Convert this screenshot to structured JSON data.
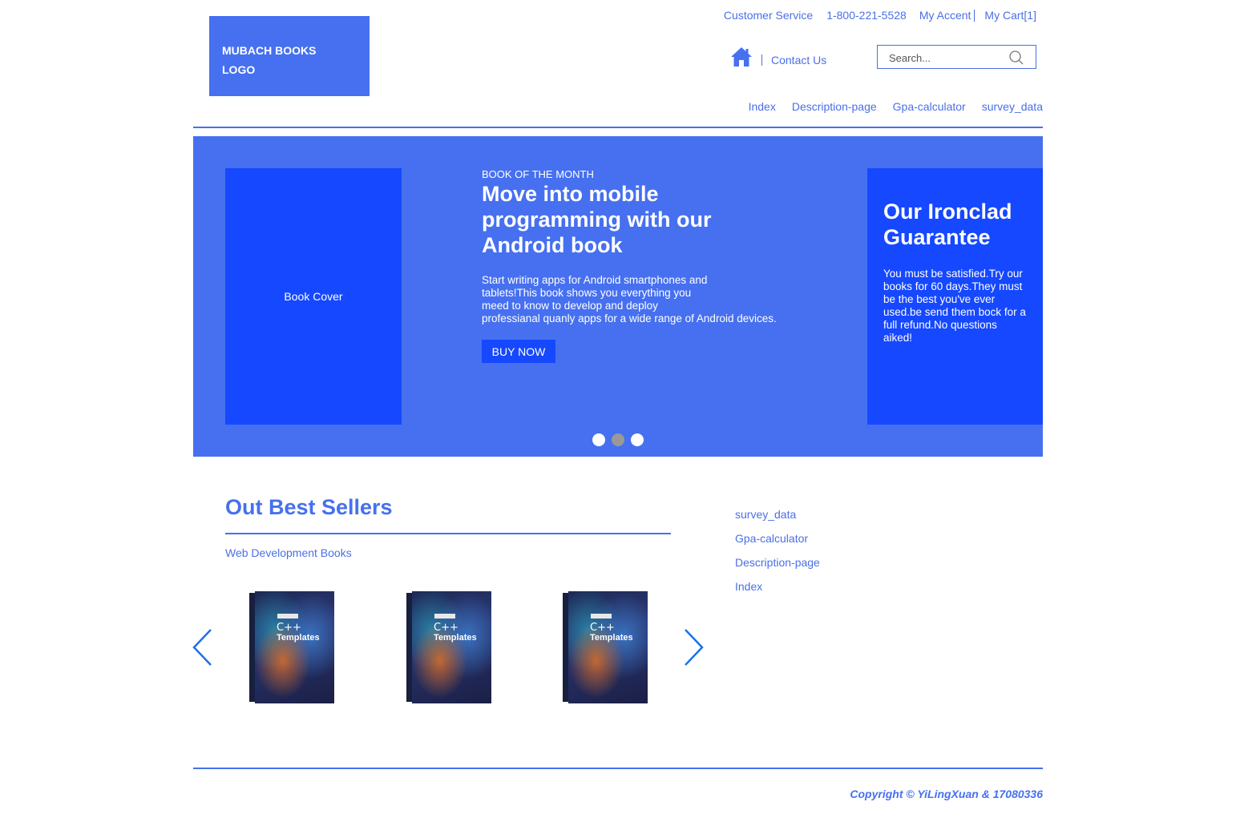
{
  "header": {
    "logo_text": "MUBACH BOOKS LOGO",
    "customer_service": "Customer Service",
    "phone": "1-800-221-5528",
    "my_account": "My Accent",
    "my_cart": "My Cart[1]",
    "contact_us": "Contact Us",
    "search_placeholder": "Search...",
    "nav": [
      "Index",
      "Description-page",
      "Gpa-calculator",
      "survey_data"
    ]
  },
  "hero": {
    "cover_label": "Book Cover",
    "kicker": "BOOK OF THE MONTH",
    "headline": "Move into mobile programming with our Android book",
    "blurb_lines": [
      "Start writing apps for Android smartphones and",
      "tablets!This book shows you everything you",
      "meed to know to develop and deploy",
      "professianal quanly apps for a wide range of Android devices."
    ],
    "buy_label": "BUY NOW",
    "guarantee_title": "Our Ironclad Guarantee",
    "guarantee_text": "You must be satisfied.Try our books for 60 days.They must be the best you've ever used.be send them bock for a full refund.No questions aiked!",
    "slides": 3,
    "active_slide": 2
  },
  "best_sellers": {
    "title": "Out Best Sellers",
    "subtitle": "Web Development Books",
    "books": [
      {
        "title_line1": "C++",
        "title_line2": "Templates"
      },
      {
        "title_line1": "C++",
        "title_line2": "Templates"
      },
      {
        "title_line1": "C++",
        "title_line2": "Templates"
      }
    ]
  },
  "side_links": [
    "survey_data",
    "Gpa-calculator",
    "Description-page",
    "Index"
  ],
  "footer": {
    "copyright": "Copyright © YiLingXuan & 17080336"
  },
  "colors": {
    "primary": "#4670f0",
    "accent": "#1548ff",
    "link": "#4a6fe6",
    "arrow": "#1a73e8"
  },
  "icons": {
    "home": "home-icon",
    "search": "search-icon",
    "prev": "chevron-left-icon",
    "next": "chevron-right-icon"
  }
}
